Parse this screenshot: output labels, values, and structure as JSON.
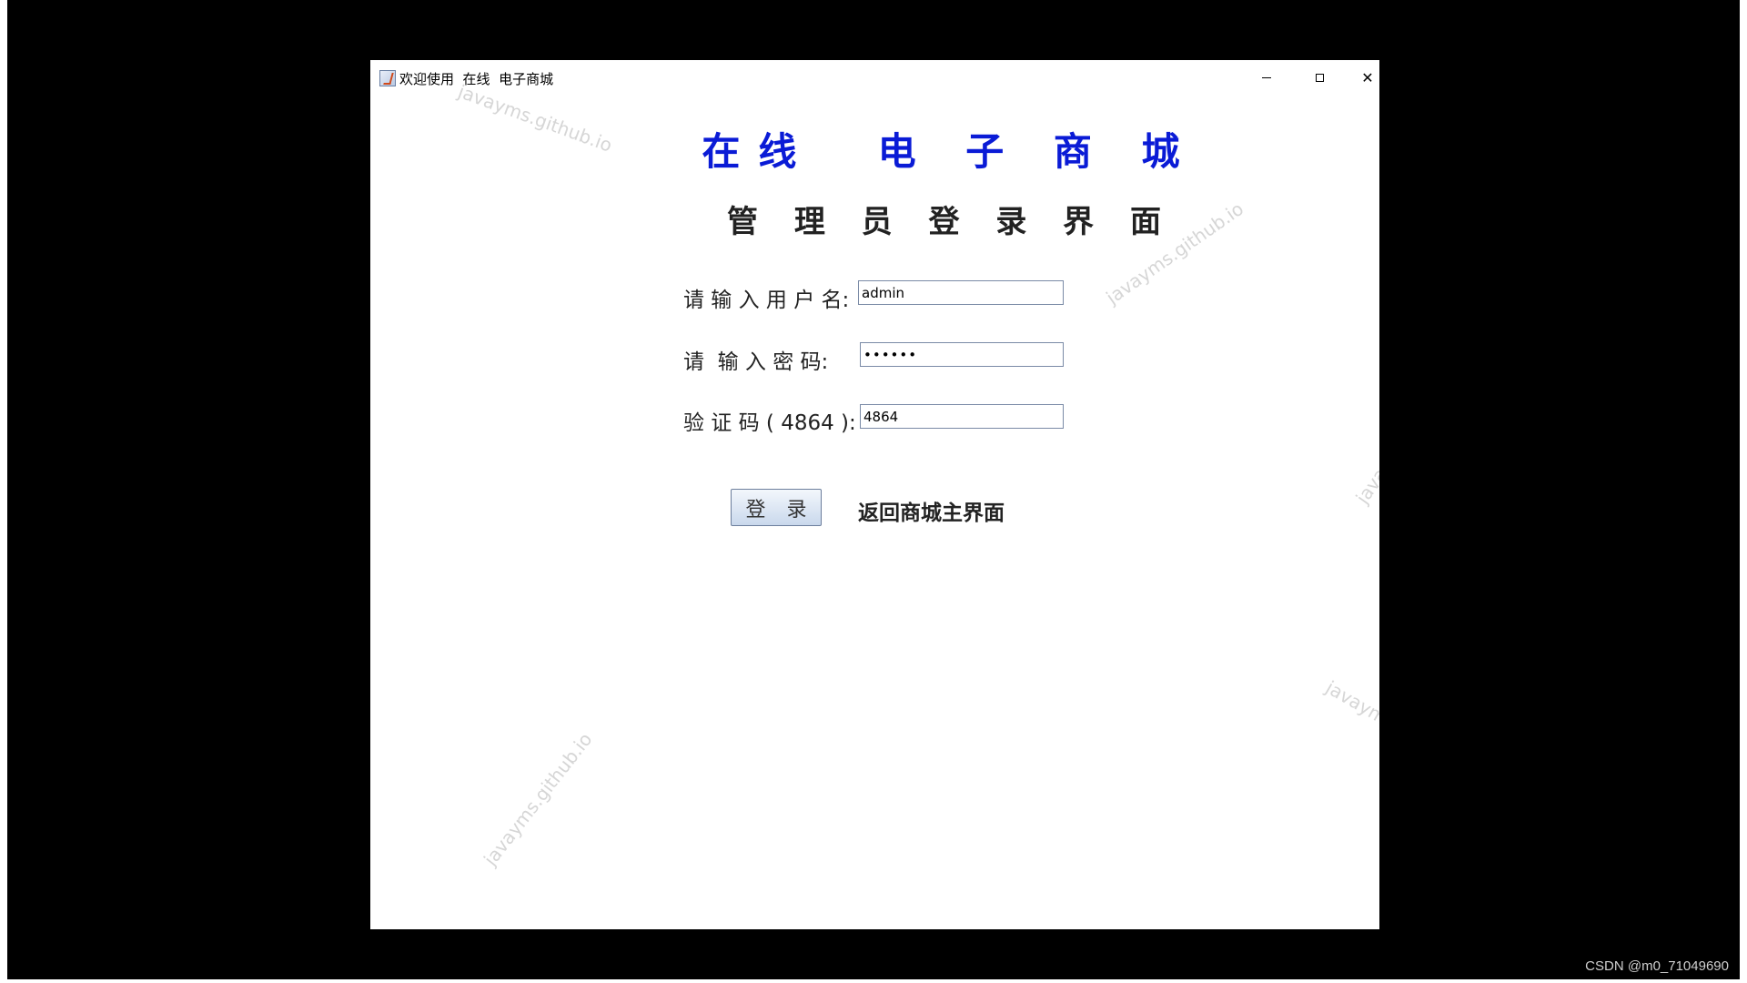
{
  "window": {
    "title": "欢迎使用  在线  电子商城",
    "controls": {
      "minimize_icon": "minimize-icon",
      "maximize_icon": "maximize-icon",
      "close_icon": "close-icon",
      "close_glyph": "✕"
    }
  },
  "header": {
    "main_title": "在线  电 子 商 城",
    "subtitle": "管 理 员 登 录 界 面"
  },
  "form": {
    "username_label": "请 输 入 用 户 名:",
    "username_value": "admin",
    "password_label": "请  输 入 密 码:",
    "password_value": "••••••",
    "captcha_label": "验 证 码 ( 4864 ):",
    "captcha_value": "4864",
    "login_button": "登 录",
    "back_link": "返回商城主界面"
  },
  "watermark_text": "javayms.github.io",
  "credit": "CSDN @m0_71049690",
  "colors": {
    "main_title": "#0a1bd6",
    "text": "#222222",
    "background": "#000000",
    "window": "#ffffff"
  }
}
